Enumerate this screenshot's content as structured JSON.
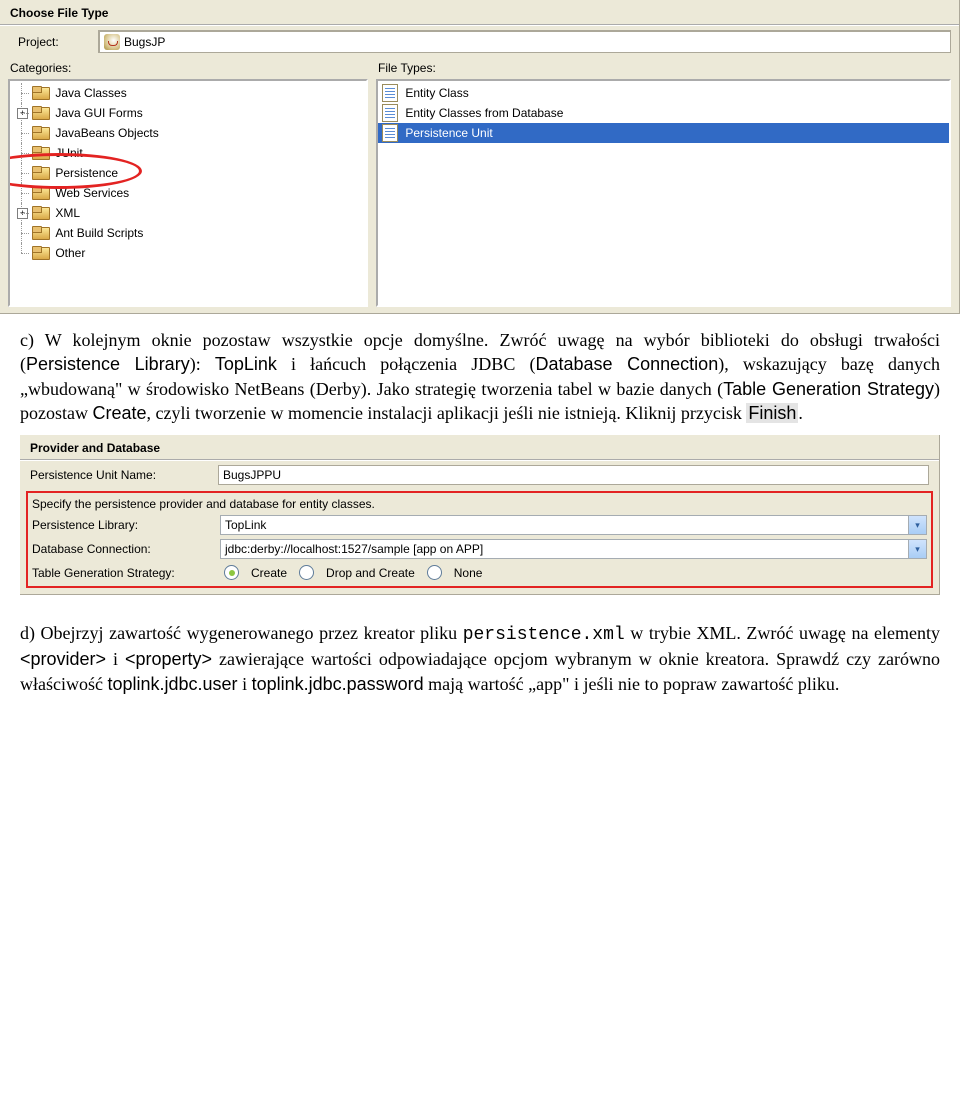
{
  "wizard1": {
    "title": "Choose File Type",
    "project_label": "Project:",
    "project_value": "BugsJP",
    "categories_label": "Categories:",
    "categories": [
      {
        "label": "Java Classes",
        "expand": null
      },
      {
        "label": "Java GUI Forms",
        "expand": "+"
      },
      {
        "label": "JavaBeans Objects",
        "expand": null
      },
      {
        "label": "JUnit",
        "expand": null
      },
      {
        "label": "Persistence",
        "expand": null,
        "circled": true
      },
      {
        "label": "Web Services",
        "expand": null
      },
      {
        "label": "XML",
        "expand": "+"
      },
      {
        "label": "Ant Build Scripts",
        "expand": null
      },
      {
        "label": "Other",
        "expand": null
      }
    ],
    "filetypes_label": "File Types:",
    "filetypes": [
      {
        "label": "Entity Class",
        "selected": false
      },
      {
        "label": "Entity Classes from Database",
        "selected": false
      },
      {
        "label": "Persistence Unit",
        "selected": true
      }
    ]
  },
  "para_c": {
    "lead": "c) W kolejnym oknie pozostaw wszystkie opcje domyślne. Zwróć uwagę na wybór biblioteki do obsługi trwałości (",
    "pl": "Persistence Library",
    "mid1": "): ",
    "topLink": "TopLink",
    "mid2": " i łańcuch połączenia JDBC (",
    "dc": "Database Connection",
    "mid3": "), wskazujący bazę danych „wbudowaną\" w środowisko NetBeans (Derby). Jako strategię tworzenia tabel w bazie danych (",
    "tgs": "Table Generation Strategy",
    "mid4": ") pozostaw ",
    "create": "Create",
    "mid5": ", czyli tworzenie w momencie instalacji aplikacji jeśli nie istnieją. Kliknij przycisk ",
    "finish": "Finish",
    "end": "."
  },
  "wizard2": {
    "title": "Provider and Database",
    "pu_label": "Persistence Unit Name:",
    "pu_value": "BugsJPPU",
    "specify": "Specify the persistence provider and database for entity classes.",
    "pl_label": "Persistence Library:",
    "pl_value": "TopLink",
    "dc_label": "Database Connection:",
    "dc_value": "jdbc:derby://localhost:1527/sample [app on APP]",
    "tgs_label": "Table Generation Strategy:",
    "tgs_opts": [
      "Create",
      "Drop and Create",
      "None"
    ]
  },
  "para_d": {
    "lead": "d) Obejrzyj zawartość wygenerowanego przez kreator pliku ",
    "file": "persistence.xml",
    "mid1": " w trybie XML. Zwróć uwagę na elementy ",
    "e1": "<provider>",
    "mid2": " i ",
    "e2": "<property>",
    "mid3": " zawierające wartości odpowiadające opcjom wybranym w oknie kreatora. Sprawdź czy zarówno właściwość ",
    "p1": "toplink.jdbc.user",
    "mid4": " i ",
    "p2": "toplink.jdbc.password",
    "mid5": " mają wartość „app\" i jeśli nie to popraw zawartość pliku."
  }
}
